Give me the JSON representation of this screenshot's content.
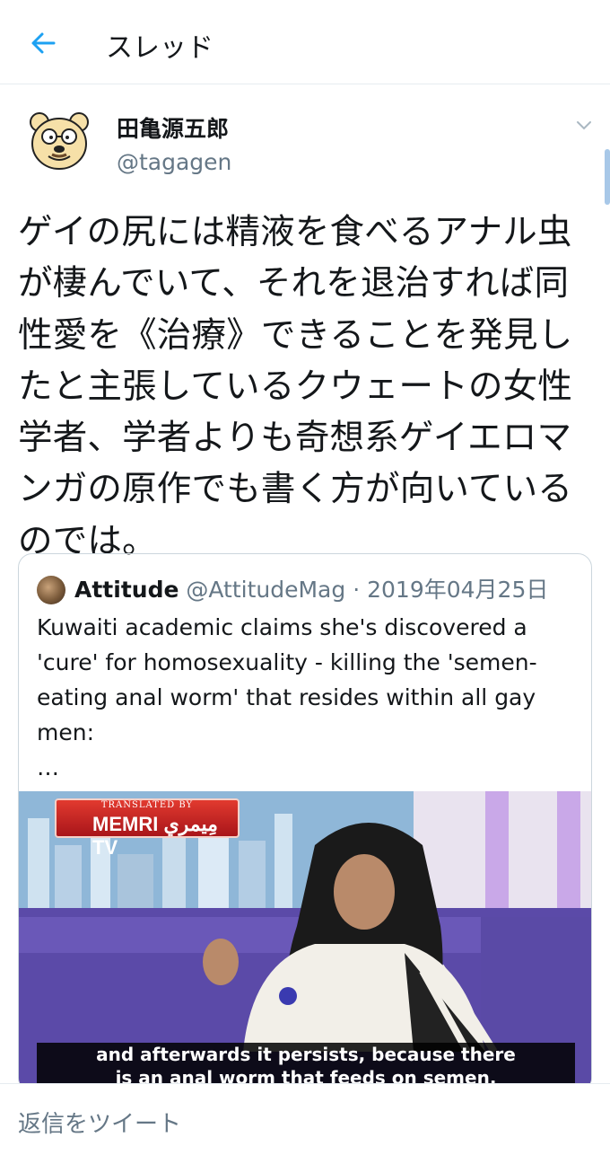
{
  "header": {
    "back_icon": "arrow-left-icon",
    "title": "スレッド"
  },
  "tweet": {
    "display_name": "田亀源五郎",
    "username": "@tagagen",
    "text_lines": [
      "ゲイの尻には精液を食べるアナル虫",
      "が棲んでいて、それを退治すれば同",
      "性愛を《治療》できることを発見し",
      "たと主張しているクウェートの女性",
      "学者、学者よりも奇想系ゲイエロマ",
      "ンガの原作でも書く方が向いている",
      "のでは。"
    ]
  },
  "quote": {
    "name": "Attitude",
    "handle": "@AttitudeMag",
    "separator": "·",
    "date": "2019年04月25日",
    "text_lines": [
      "Kuwaiti academic claims she's discovered a",
      "'cure' for homosexuality - killing the 'semen-",
      "eating anal worm' that resides within all gay",
      "men:",
      "…"
    ],
    "media": {
      "logo_top": "TRANSLATED BY",
      "logo_text": "MEMRI مِيمري TV",
      "caption_line1": "and afterwards it persists, because there",
      "caption_line2": "is an anal worm that feeds on semen."
    }
  },
  "reply": {
    "placeholder": "返信をツイート"
  },
  "colors": {
    "accent": "#1da1f2",
    "secondary_text": "#657786",
    "border": "#e6ecf0"
  }
}
